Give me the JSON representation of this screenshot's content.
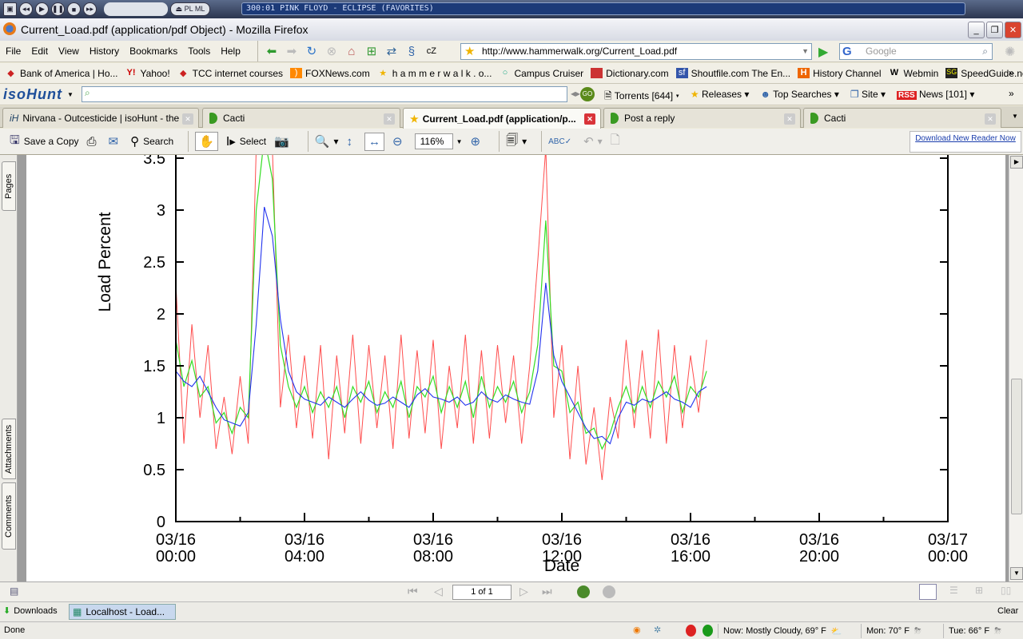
{
  "winamp": {
    "track": "300:01 PINK FLOYD - ECLIPSE (FAVORITES)"
  },
  "window": {
    "title": "Current_Load.pdf (application/pdf Object) - Mozilla Firefox"
  },
  "menu": [
    "File",
    "Edit",
    "View",
    "History",
    "Bookmarks",
    "Tools",
    "Help"
  ],
  "address": {
    "url": "http://www.hammerwalk.org/Current_Load.pdf"
  },
  "search": {
    "placeholder": "Google"
  },
  "bookmarks": [
    "Bank of America | Ho...",
    "Yahoo!",
    "TCC internet courses",
    "FOXNews.com",
    "h a m m e r w a l k . o...",
    "Campus Cruiser",
    "Dictionary.com",
    "Shoutfile.com The En...",
    "History Channel",
    "Webmin",
    "SpeedGuide.net :: Yo..."
  ],
  "isohunt": {
    "logo": "isoHunt",
    "items": [
      "Torrents [644]",
      "Releases",
      "Top Searches",
      "Site",
      "News [101]"
    ],
    "rss": "RSS"
  },
  "tabs": [
    {
      "label": "Nirvana - Outcesticide | isoHunt - the ...",
      "active": false
    },
    {
      "label": "Cacti",
      "active": false
    },
    {
      "label": "Current_Load.pdf (application/p...",
      "active": true
    },
    {
      "label": "Post a reply",
      "active": false
    },
    {
      "label": "Cacti",
      "active": false
    }
  ],
  "pdf_toolbar": {
    "save": "Save a Copy",
    "search": "Search",
    "select": "Select",
    "zoom": "116%",
    "download_reader": "Download New Reader Now"
  },
  "side_tabs": [
    "Pages",
    "Attachments",
    "Comments"
  ],
  "pdf_nav": {
    "page": "1 of 1"
  },
  "downloads": {
    "label": "Downloads",
    "item": "Localhost - Load...",
    "clear": "Clear"
  },
  "status": {
    "text": "Done",
    "weather_now": "Now: Mostly Cloudy, 69° F",
    "weather_mon": "Mon: 70° F",
    "weather_tue": "Tue: 66° F"
  },
  "chart_data": {
    "type": "line",
    "title": "",
    "xlabel": "Date",
    "ylabel": "Load Percent",
    "ylim": [
      0,
      3.5
    ],
    "yticks": [
      "0",
      "0.5",
      "1",
      "1.5",
      "2",
      "2.5",
      "3",
      "3.5"
    ],
    "xlim_hours": [
      0,
      24
    ],
    "xticks": [
      {
        "date": "03/16",
        "time": "00:00"
      },
      {
        "date": "03/16",
        "time": "04:00"
      },
      {
        "date": "03/16",
        "time": "08:00"
      },
      {
        "date": "03/16",
        "time": "12:00"
      },
      {
        "date": "03/16",
        "time": "16:00"
      },
      {
        "date": "03/16",
        "time": "20:00"
      },
      {
        "date": "03/17",
        "time": "00:00"
      }
    ],
    "x_start": "03/16 00:00",
    "x_step_minutes": 15,
    "grid": false,
    "series": [
      {
        "color": "#ff2020",
        "values": [
          2.3,
          0.75,
          1.9,
          1.0,
          1.7,
          0.7,
          1.2,
          0.65,
          1.4,
          0.75,
          3.6,
          3.6,
          3.6,
          1.1,
          1.8,
          0.9,
          1.6,
          0.8,
          1.7,
          0.6,
          1.6,
          0.85,
          1.8,
          0.75,
          1.7,
          0.9,
          1.6,
          0.7,
          1.8,
          0.8,
          1.65,
          0.85,
          1.75,
          0.7,
          1.5,
          0.9,
          1.8,
          0.75,
          1.65,
          0.8,
          1.7,
          0.95,
          1.6,
          0.75,
          1.5,
          2.5,
          3.6,
          1.0,
          1.7,
          0.6,
          1.5,
          0.55,
          1.1,
          0.4,
          1.2,
          0.8,
          1.75,
          0.9,
          1.65,
          0.8,
          1.85,
          0.75,
          1.7,
          0.9,
          1.6,
          1.05,
          1.75
        ]
      },
      {
        "color": "#33dd22",
        "values": [
          1.75,
          1.3,
          1.55,
          1.2,
          1.3,
          0.95,
          1.05,
          0.85,
          1.1,
          1.0,
          3.0,
          3.7,
          3.3,
          1.7,
          1.3,
          1.1,
          1.3,
          1.05,
          1.25,
          1.1,
          1.3,
          1.0,
          1.3,
          1.15,
          1.35,
          1.05,
          1.25,
          1.1,
          1.35,
          1.0,
          1.3,
          1.2,
          1.4,
          1.05,
          1.3,
          1.1,
          1.35,
          1.0,
          1.4,
          1.1,
          1.3,
          1.15,
          1.35,
          1.05,
          1.25,
          1.7,
          2.9,
          1.5,
          1.45,
          1.05,
          1.15,
          0.85,
          0.9,
          0.7,
          0.85,
          1.1,
          1.3,
          1.05,
          1.3,
          1.1,
          1.35,
          1.2,
          1.4,
          1.05,
          1.3,
          1.2,
          1.45
        ]
      },
      {
        "color": "#2233ee",
        "values": [
          1.45,
          1.35,
          1.3,
          1.4,
          1.25,
          1.1,
          0.98,
          0.95,
          0.92,
          1.05,
          1.9,
          3.03,
          2.75,
          1.95,
          1.45,
          1.25,
          1.18,
          1.15,
          1.12,
          1.2,
          1.15,
          1.1,
          1.18,
          1.25,
          1.17,
          1.12,
          1.14,
          1.2,
          1.15,
          1.1,
          1.22,
          1.28,
          1.2,
          1.18,
          1.15,
          1.2,
          1.12,
          1.15,
          1.25,
          1.18,
          1.15,
          1.22,
          1.18,
          1.15,
          1.13,
          1.45,
          2.3,
          1.6,
          1.35,
          1.2,
          1.05,
          0.9,
          0.8,
          0.82,
          0.75,
          1.0,
          1.15,
          1.12,
          1.18,
          1.15,
          1.2,
          1.25,
          1.18,
          1.15,
          1.1,
          1.25,
          1.3
        ]
      }
    ]
  }
}
